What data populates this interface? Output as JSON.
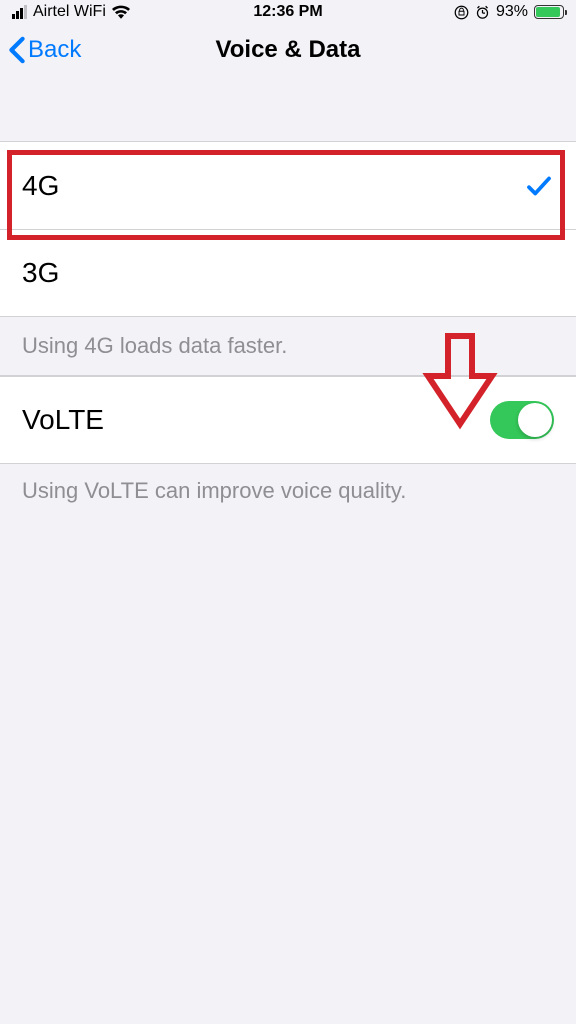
{
  "statusBar": {
    "carrier": "Airtel WiFi",
    "time": "12:36 PM",
    "batteryPercent": "93%"
  },
  "nav": {
    "back": "Back",
    "title": "Voice & Data"
  },
  "options": [
    {
      "label": "4G",
      "selected": true
    },
    {
      "label": "3G",
      "selected": false
    }
  ],
  "optionsFooter": "Using 4G loads data faster.",
  "volte": {
    "label": "VoLTE",
    "on": true
  },
  "volteFooter": "Using VoLTE can improve voice quality."
}
